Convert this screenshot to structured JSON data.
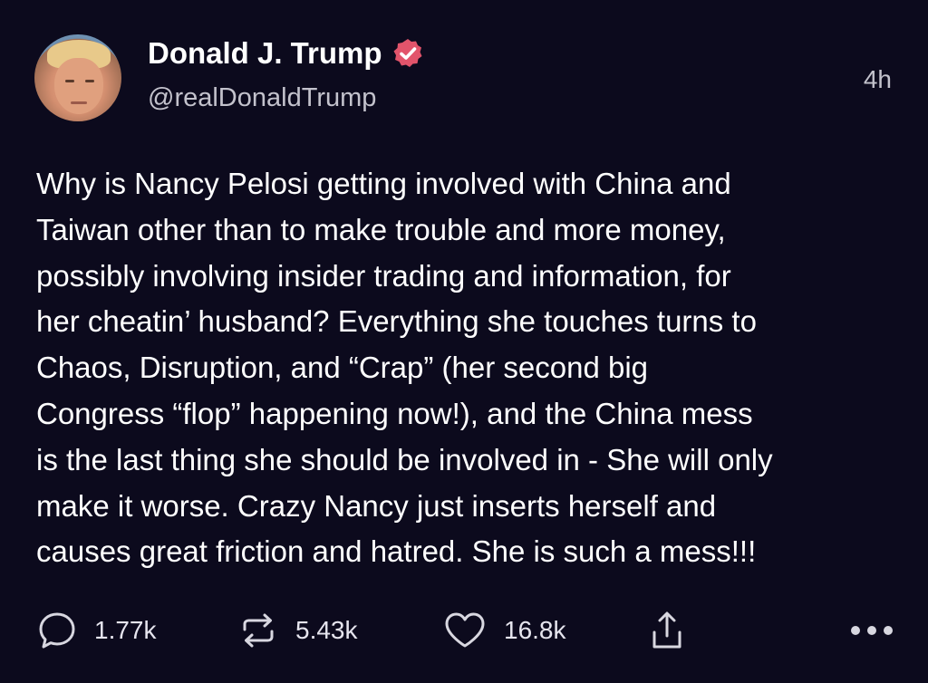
{
  "author": {
    "name": "Donald J. Trump",
    "handle": "@realDonaldTrump",
    "verified": true,
    "avatar_icon": "profile-photo"
  },
  "post": {
    "time": "4h",
    "text": "Why is Nancy Pelosi getting involved with China and\nTaiwan other than to make trouble and more money,\npossibly involving insider trading and information, for\nher cheatin’ husband? Everything she touches turns to\nChaos, Disruption, and “Crap” (her second big\nCongress “flop” happening now!), and the China mess\nis the last thing she should be involved in - She will only\nmake it worse. Crazy Nancy just inserts herself and\ncauses great friction and hatred. She is such a mess!!!"
  },
  "actions": {
    "reply": {
      "icon": "reply-icon",
      "count": "1.77k"
    },
    "repost": {
      "icon": "repost-icon",
      "count": "5.43k"
    },
    "like": {
      "icon": "heart-icon",
      "count": "16.8k"
    },
    "share": {
      "icon": "share-icon"
    },
    "more": {
      "icon": "more-icon"
    }
  },
  "colors": {
    "background": "#0c0a1d",
    "text": "#ffffff",
    "muted": "#c3c2cc",
    "verified_badge": "#e2546b"
  }
}
